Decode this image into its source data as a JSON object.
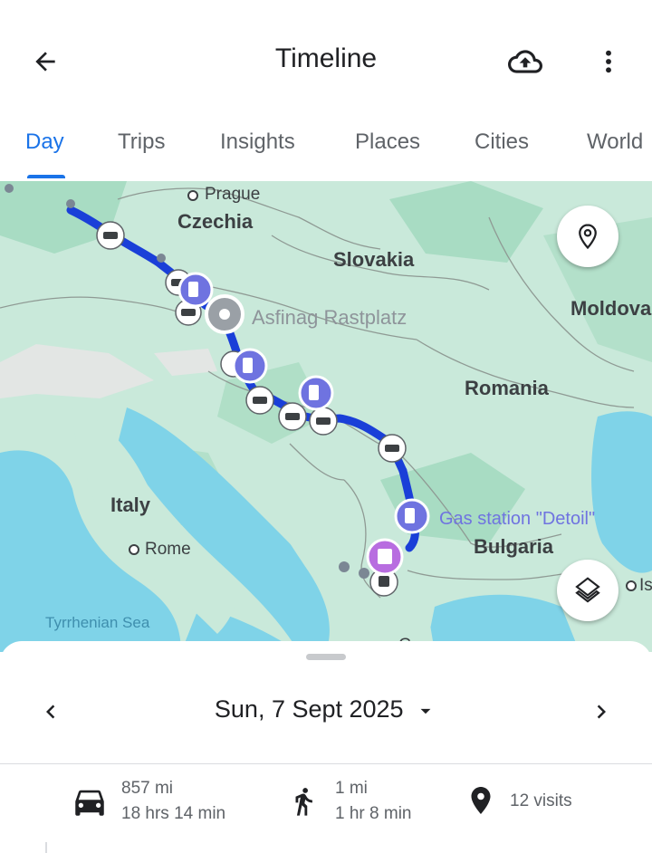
{
  "header": {
    "title": "Timeline",
    "back_icon": "arrow-back-icon",
    "upload_icon": "cloud-upload-icon",
    "more_icon": "more-vert-icon"
  },
  "tabs": [
    {
      "label": "Day",
      "active": true
    },
    {
      "label": "Trips",
      "active": false
    },
    {
      "label": "Insights",
      "active": false
    },
    {
      "label": "Places",
      "active": false
    },
    {
      "label": "Cities",
      "active": false
    },
    {
      "label": "World",
      "active": false
    }
  ],
  "map": {
    "labels": {
      "prague": "Prague",
      "czechia": "Czechia",
      "slovakia": "Slovakia",
      "moldova": "Moldova",
      "asfinag": "Asfinag Rastplatz",
      "romania": "Romania",
      "italy": "Italy",
      "gas_station": "Gas station \"Detoil\"",
      "bulgaria": "Bulgaria",
      "rome": "Rome",
      "tyrrhenian": "Tyrrhenian Sea",
      "istanbul_partial": "Is",
      "bottom_partial": "G"
    },
    "route_color": "#1a3fd8",
    "place_marker_color": "#6f73e0",
    "attraction_marker_color": "#b86de0",
    "location_button_icon": "map-pin-icon",
    "layers_button_icon": "layers-icon"
  },
  "sheet": {
    "date": "Sun, 7 Sept 2025",
    "prev_icon": "chevron-left-icon",
    "next_icon": "chevron-right-icon",
    "dropdown_icon": "caret-down-icon",
    "stats": {
      "drive": {
        "distance": "857 mi",
        "duration": "18 hrs 14 min",
        "icon": "car-icon"
      },
      "walk": {
        "distance": "1 mi",
        "duration": "1 hr 8 min",
        "icon": "walk-icon"
      },
      "visits": {
        "text": "12 visits",
        "icon": "location-pin-icon"
      }
    }
  }
}
